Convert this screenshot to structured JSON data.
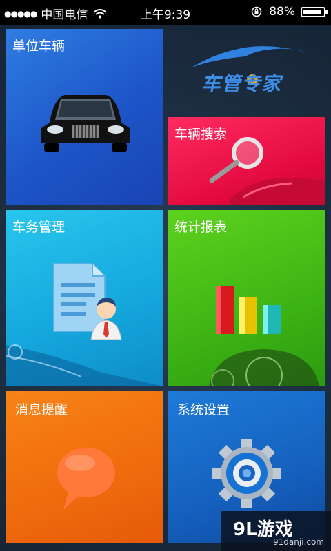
{
  "status_bar": {
    "carrier": "中国电信",
    "time": "上午9:39",
    "battery": "88%",
    "battery_level": 0.88
  },
  "brand": {
    "logo_text": "车管专家"
  },
  "tiles": {
    "vehicles": "单位车辆",
    "search": "车辆搜索",
    "affairs": "车务管理",
    "stats": "统计报表",
    "messages": "消息提醒",
    "settings": "系统设置"
  },
  "watermark": {
    "main": "9L游戏",
    "sub": "91danji.com"
  },
  "colors": {
    "vehicles": "#1d55c7",
    "search": "#e2093d",
    "affairs": "#14a6dc",
    "stats": "#3db414",
    "messages": "#ef6b0d",
    "settings": "#1561be"
  }
}
